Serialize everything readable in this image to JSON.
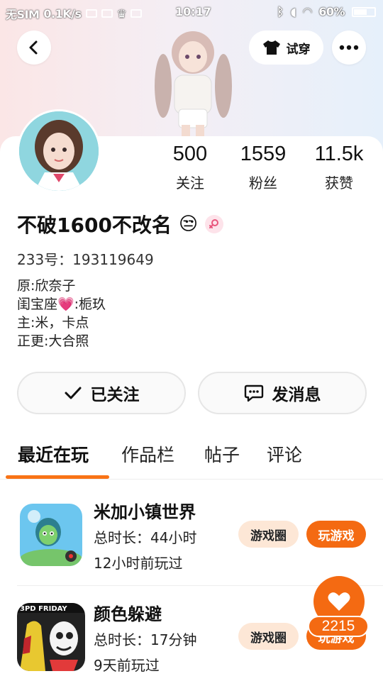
{
  "status_bar": {
    "carrier": "无SIM",
    "speed": "0.1K/s",
    "time": "10:17",
    "battery": "60%"
  },
  "header": {
    "try_on_label": "试穿",
    "icons": [
      "back-icon",
      "shirt-icon",
      "more-icon"
    ]
  },
  "stats": [
    {
      "value": "500",
      "label": "关注"
    },
    {
      "value": "1559",
      "label": "粉丝"
    },
    {
      "value": "11.5k",
      "label": "获赞"
    }
  ],
  "profile": {
    "username": "不破1600不改名",
    "emoji": "😒",
    "uid": "233号：193119649",
    "bio": [
      "原:欣奈子",
      "闺宝座💗:栀玖",
      "主:米，卡点",
      "正更:大合照"
    ]
  },
  "actions": {
    "follow_label": "已关注",
    "message_label": "发消息"
  },
  "tabs": [
    "最近在玩",
    "作品栏",
    "帖子",
    "评论"
  ],
  "games": [
    {
      "title": "米加小镇世界",
      "duration": "总时长：44小时",
      "last_played": "12小时前玩过",
      "circle_label": "游戏圈",
      "play_label": "玩游戏"
    },
    {
      "title": "颜色躲避",
      "duration": "总时长：17分钟",
      "last_played": "9天前玩过",
      "circle_label": "游戏圈",
      "play_label": "玩游戏",
      "icon_text": "3PD FRIDAY"
    }
  ],
  "like": {
    "count": "2215"
  },
  "colors": {
    "accent": "#f46a12",
    "pill_bg": "#fde7d6",
    "header_left": "#fbe6e6",
    "header_right": "#e6f0fb"
  }
}
